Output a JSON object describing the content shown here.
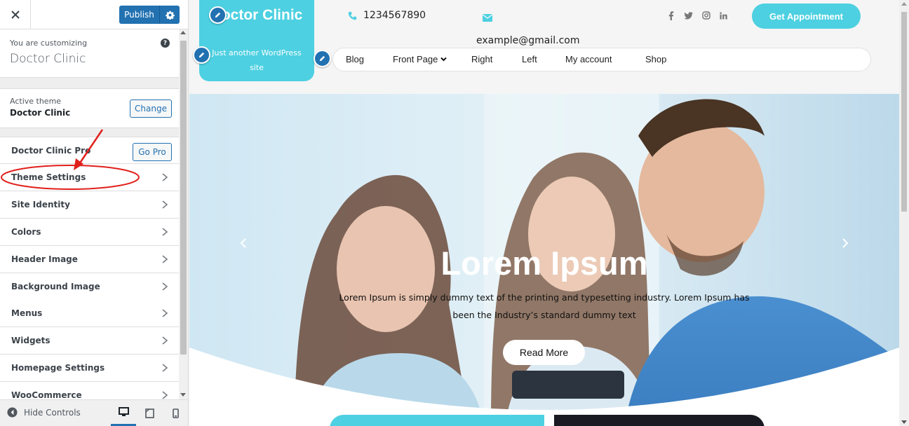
{
  "sidebar": {
    "publish_label": "Publish",
    "customizing_label": "You are customizing",
    "customizing_title": "Doctor Clinic",
    "help_symbol": "?",
    "active_theme_label": "Active theme",
    "active_theme_name": "Doctor Clinic",
    "change_label": "Change",
    "pro_label": "Doctor Clinic Pro",
    "gopro_label": "Go Pro",
    "sections": [
      "Theme Settings",
      "Site Identity",
      "Colors",
      "Header Image",
      "Background Image",
      "Menus",
      "Widgets",
      "Homepage Settings",
      "WooCommerce"
    ],
    "hide_controls_label": "Hide Controls",
    "accent_color": "#2271b1"
  },
  "preview": {
    "site_title": "Doctor Clinic",
    "site_tagline": "Just another WordPress site",
    "phone": "1234567890",
    "email": "example@gmail.com",
    "social_icons": [
      "facebook-icon",
      "twitter-icon",
      "instagram-icon",
      "linkedin-icon"
    ],
    "appointment_label": "Get Appointment",
    "nav": [
      "Blog",
      "Front Page",
      "Right",
      "Left",
      "My account",
      "Shop"
    ],
    "hero_heading": "Lorem Ipsum",
    "hero_text": "Lorem Ipsum is simply dummy text of the printing and typesetting industry. Lorem Ipsum has been the Industry’s standard dummy text",
    "read_more_label": "Read More",
    "brand_color": "#4dd0e1"
  },
  "annotation": {
    "color": "#e0201c",
    "target": "Theme Settings"
  }
}
